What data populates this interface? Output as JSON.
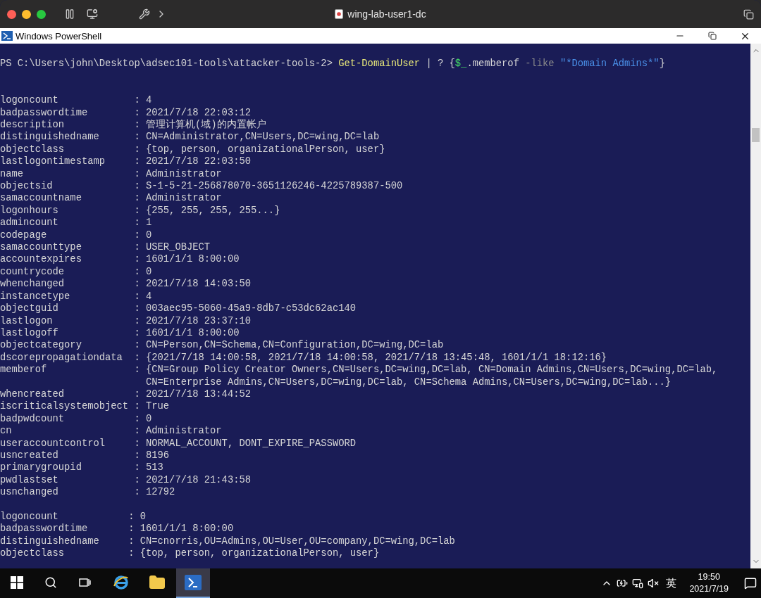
{
  "window": {
    "title": "wing-lab-user1-dc"
  },
  "app": {
    "title": "Windows PowerShell"
  },
  "console": {
    "command": [
      {
        "kind": "prompt",
        "text": "PS C:\\Users\\john\\Desktop\\adsec101-tools\\attacker-tools-2> "
      },
      {
        "kind": "cmdlet",
        "text": "Get-DomainUser"
      },
      {
        "kind": "plain",
        "text": " | ? {"
      },
      {
        "kind": "variable",
        "text": "$_"
      },
      {
        "kind": "plain",
        "text": ".memberof "
      },
      {
        "kind": "operator",
        "text": "-like "
      },
      {
        "kind": "string",
        "text": "\"*Domain Admins*\""
      },
      {
        "kind": "plain",
        "text": "}"
      }
    ],
    "records": [
      {
        "lines": [
          "logoncount             : 4",
          "badpasswordtime        : 2021/7/18 22:03:12",
          "description            : 管理计算机(域)的内置帐户",
          "distinguishedname      : CN=Administrator,CN=Users,DC=wing,DC=lab",
          "objectclass            : {top, person, organizationalPerson, user}",
          "lastlogontimestamp     : 2021/7/18 22:03:50",
          "name                   : Administrator",
          "objectsid              : S-1-5-21-256878070-3651126246-4225789387-500",
          "samaccountname         : Administrator",
          "logonhours             : {255, 255, 255, 255...}",
          "admincount             : 1",
          "codepage               : 0",
          "samaccounttype         : USER_OBJECT",
          "accountexpires         : 1601/1/1 8:00:00",
          "countrycode            : 0",
          "whenchanged            : 2021/7/18 14:03:50",
          "instancetype           : 4",
          "objectguid             : 003aec95-5060-45a9-8db7-c53dc62ac140",
          "lastlogon              : 2021/7/18 23:37:10",
          "lastlogoff             : 1601/1/1 8:00:00",
          "objectcategory         : CN=Person,CN=Schema,CN=Configuration,DC=wing,DC=lab",
          "dscorepropagationdata  : {2021/7/18 14:00:58, 2021/7/18 14:00:58, 2021/7/18 13:45:48, 1601/1/1 18:12:16}",
          "memberof               : {CN=Group Policy Creator Owners,CN=Users,DC=wing,DC=lab, CN=Domain Admins,CN=Users,DC=wing,DC=lab,",
          "                         CN=Enterprise Admins,CN=Users,DC=wing,DC=lab, CN=Schema Admins,CN=Users,DC=wing,DC=lab...}",
          "whencreated            : 2021/7/18 13:44:52",
          "iscriticalsystemobject : True",
          "badpwdcount            : 0",
          "cn                     : Administrator",
          "useraccountcontrol     : NORMAL_ACCOUNT, DONT_EXPIRE_PASSWORD",
          "usncreated             : 8196",
          "primarygroupid         : 513",
          "pwdlastset             : 2021/7/18 21:43:58",
          "usnchanged             : 12792"
        ]
      },
      {
        "lines": [
          "logoncount            : 0",
          "badpasswordtime       : 1601/1/1 8:00:00",
          "distinguishedname     : CN=cnorris,OU=Admins,OU=User,OU=company,DC=wing,DC=lab",
          "objectclass           : {top, person, organizationalPerson, user}"
        ]
      }
    ]
  },
  "taskbar": {
    "apps": [
      {
        "kind": "browser",
        "selected": false
      },
      {
        "kind": "explorer",
        "selected": false
      },
      {
        "kind": "powershell",
        "selected": true
      }
    ],
    "ime": "英",
    "time": "19:50",
    "date": "2021/7/19"
  }
}
